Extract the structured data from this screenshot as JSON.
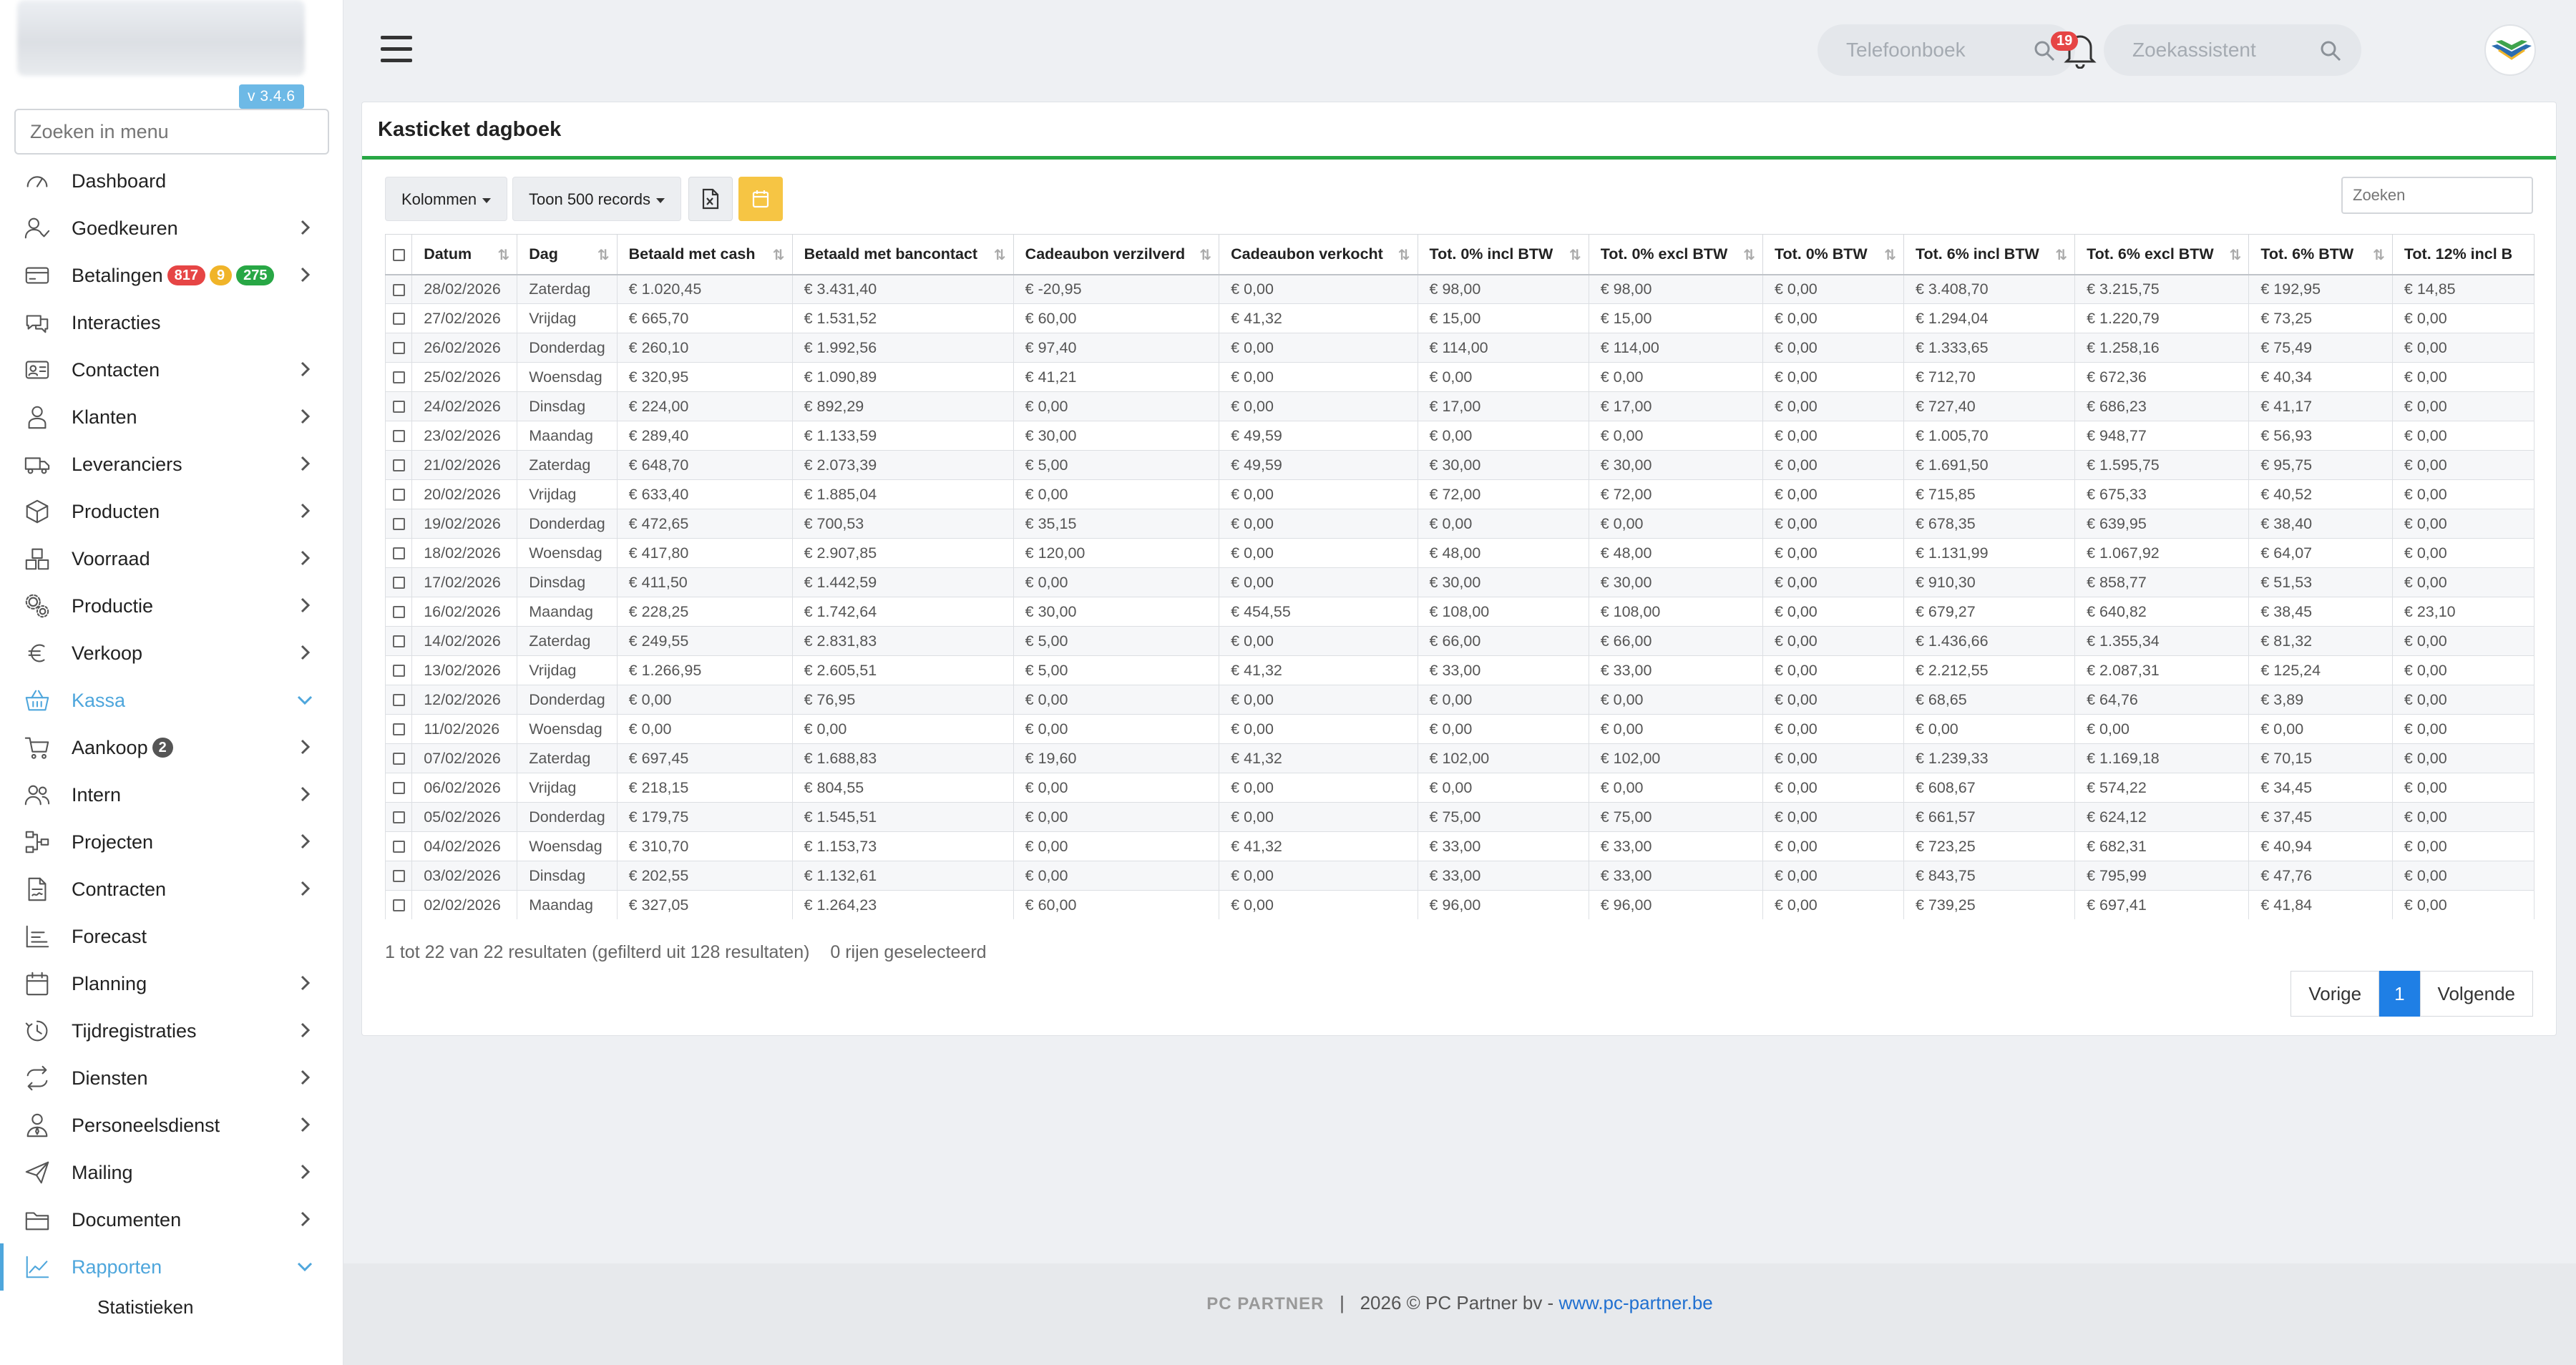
{
  "sidebar": {
    "version": "v 3.4.6",
    "search_placeholder": "Zoeken in menu",
    "items": [
      {
        "label": "Dashboard",
        "icon": "speedometer-icon",
        "chevron": false
      },
      {
        "label": "Goedkeuren",
        "icon": "user-check-icon",
        "chevron": true
      },
      {
        "label": "Betalingen",
        "icon": "credit-card-icon",
        "chevron": true,
        "badges": [
          "817",
          "9",
          "275"
        ]
      },
      {
        "label": "Interacties",
        "icon": "chat-icon",
        "chevron": false
      },
      {
        "label": "Contacten",
        "icon": "contact-card-icon",
        "chevron": true
      },
      {
        "label": "Klanten",
        "icon": "user-icon",
        "chevron": true
      },
      {
        "label": "Leveranciers",
        "icon": "truck-icon",
        "chevron": true
      },
      {
        "label": "Producten",
        "icon": "box-icon",
        "chevron": true
      },
      {
        "label": "Voorraad",
        "icon": "boxes-icon",
        "chevron": true
      },
      {
        "label": "Productie",
        "icon": "gears-icon",
        "chevron": true
      },
      {
        "label": "Verkoop",
        "icon": "euro-icon",
        "chevron": true
      },
      {
        "label": "Kassa",
        "icon": "basket-icon",
        "chevron": true,
        "active": true
      },
      {
        "label": "Aankoop",
        "icon": "cart-icon",
        "chevron": true,
        "badges": [
          "2"
        ]
      },
      {
        "label": "Intern",
        "icon": "users-icon",
        "chevron": true
      },
      {
        "label": "Projecten",
        "icon": "project-icon",
        "chevron": true
      },
      {
        "label": "Contracten",
        "icon": "contract-icon",
        "chevron": true
      },
      {
        "label": "Forecast",
        "icon": "bar-chart-icon",
        "chevron": false
      },
      {
        "label": "Planning",
        "icon": "calendar-icon",
        "chevron": true
      },
      {
        "label": "Tijdregistraties",
        "icon": "clock-icon",
        "chevron": true
      },
      {
        "label": "Diensten",
        "icon": "repeat-icon",
        "chevron": true
      },
      {
        "label": "Personeelsdienst",
        "icon": "person-tie-icon",
        "chevron": true
      },
      {
        "label": "Mailing",
        "icon": "send-icon",
        "chevron": true
      },
      {
        "label": "Documenten",
        "icon": "folder-icon",
        "chevron": true
      },
      {
        "label": "Rapporten",
        "icon": "line-chart-icon",
        "chevron": true,
        "active": true
      }
    ],
    "sub_items": [
      "Statistieken"
    ]
  },
  "header": {
    "phonebook_placeholder": "Telefoonboek",
    "assistant_placeholder": "Zoekassistent",
    "notification_count": "19"
  },
  "card": {
    "title": "Kasticket dagboek",
    "columns_button": "Kolommen",
    "records_button": "Toon 500 records",
    "table_search_placeholder": "Zoeken",
    "colors": {
      "accent": "#28a745",
      "calendar_button": "#f6c544",
      "primary": "#1f7fe5"
    }
  },
  "table": {
    "headers": [
      "Datum",
      "Dag",
      "Betaald met cash",
      "Betaald met bancontact",
      "Cadeaubon verzilverd",
      "Cadeaubon verkocht",
      "Tot. 0% incl BTW",
      "Tot. 0% excl BTW",
      "Tot. 0% BTW",
      "Tot. 6% incl BTW",
      "Tot. 6% excl BTW",
      "Tot. 6% BTW",
      "Tot. 12% incl B"
    ],
    "rows": [
      [
        "28/02/2026",
        "Zaterdag",
        "€ 1.020,45",
        "€ 3.431,40",
        "€ -20,95",
        "€ 0,00",
        "€ 98,00",
        "€ 98,00",
        "€ 0,00",
        "€ 3.408,70",
        "€ 3.215,75",
        "€ 192,95",
        "€ 14,85"
      ],
      [
        "27/02/2026",
        "Vrijdag",
        "€ 665,70",
        "€ 1.531,52",
        "€ 60,00",
        "€ 41,32",
        "€ 15,00",
        "€ 15,00",
        "€ 0,00",
        "€ 1.294,04",
        "€ 1.220,79",
        "€ 73,25",
        "€ 0,00"
      ],
      [
        "26/02/2026",
        "Donderdag",
        "€ 260,10",
        "€ 1.992,56",
        "€ 97,40",
        "€ 0,00",
        "€ 114,00",
        "€ 114,00",
        "€ 0,00",
        "€ 1.333,65",
        "€ 1.258,16",
        "€ 75,49",
        "€ 0,00"
      ],
      [
        "25/02/2026",
        "Woensdag",
        "€ 320,95",
        "€ 1.090,89",
        "€ 41,21",
        "€ 0,00",
        "€ 0,00",
        "€ 0,00",
        "€ 0,00",
        "€ 712,70",
        "€ 672,36",
        "€ 40,34",
        "€ 0,00"
      ],
      [
        "24/02/2026",
        "Dinsdag",
        "€ 224,00",
        "€ 892,29",
        "€ 0,00",
        "€ 0,00",
        "€ 17,00",
        "€ 17,00",
        "€ 0,00",
        "€ 727,40",
        "€ 686,23",
        "€ 41,17",
        "€ 0,00"
      ],
      [
        "23/02/2026",
        "Maandag",
        "€ 289,40",
        "€ 1.133,59",
        "€ 30,00",
        "€ 49,59",
        "€ 0,00",
        "€ 0,00",
        "€ 0,00",
        "€ 1.005,70",
        "€ 948,77",
        "€ 56,93",
        "€ 0,00"
      ],
      [
        "21/02/2026",
        "Zaterdag",
        "€ 648,70",
        "€ 2.073,39",
        "€ 5,00",
        "€ 49,59",
        "€ 30,00",
        "€ 30,00",
        "€ 0,00",
        "€ 1.691,50",
        "€ 1.595,75",
        "€ 95,75",
        "€ 0,00"
      ],
      [
        "20/02/2026",
        "Vrijdag",
        "€ 633,40",
        "€ 1.885,04",
        "€ 0,00",
        "€ 0,00",
        "€ 72,00",
        "€ 72,00",
        "€ 0,00",
        "€ 715,85",
        "€ 675,33",
        "€ 40,52",
        "€ 0,00"
      ],
      [
        "19/02/2026",
        "Donderdag",
        "€ 472,65",
        "€ 700,53",
        "€ 35,15",
        "€ 0,00",
        "€ 0,00",
        "€ 0,00",
        "€ 0,00",
        "€ 678,35",
        "€ 639,95",
        "€ 38,40",
        "€ 0,00"
      ],
      [
        "18/02/2026",
        "Woensdag",
        "€ 417,80",
        "€ 2.907,85",
        "€ 120,00",
        "€ 0,00",
        "€ 48,00",
        "€ 48,00",
        "€ 0,00",
        "€ 1.131,99",
        "€ 1.067,92",
        "€ 64,07",
        "€ 0,00"
      ],
      [
        "17/02/2026",
        "Dinsdag",
        "€ 411,50",
        "€ 1.442,59",
        "€ 0,00",
        "€ 0,00",
        "€ 30,00",
        "€ 30,00",
        "€ 0,00",
        "€ 910,30",
        "€ 858,77",
        "€ 51,53",
        "€ 0,00"
      ],
      [
        "16/02/2026",
        "Maandag",
        "€ 228,25",
        "€ 1.742,64",
        "€ 30,00",
        "€ 454,55",
        "€ 108,00",
        "€ 108,00",
        "€ 0,00",
        "€ 679,27",
        "€ 640,82",
        "€ 38,45",
        "€ 23,10"
      ],
      [
        "14/02/2026",
        "Zaterdag",
        "€ 249,55",
        "€ 2.831,83",
        "€ 5,00",
        "€ 0,00",
        "€ 66,00",
        "€ 66,00",
        "€ 0,00",
        "€ 1.436,66",
        "€ 1.355,34",
        "€ 81,32",
        "€ 0,00"
      ],
      [
        "13/02/2026",
        "Vrijdag",
        "€ 1.266,95",
        "€ 2.605,51",
        "€ 5,00",
        "€ 41,32",
        "€ 33,00",
        "€ 33,00",
        "€ 0,00",
        "€ 2.212,55",
        "€ 2.087,31",
        "€ 125,24",
        "€ 0,00"
      ],
      [
        "12/02/2026",
        "Donderdag",
        "€ 0,00",
        "€ 76,95",
        "€ 0,00",
        "€ 0,00",
        "€ 0,00",
        "€ 0,00",
        "€ 0,00",
        "€ 68,65",
        "€ 64,76",
        "€ 3,89",
        "€ 0,00"
      ],
      [
        "11/02/2026",
        "Woensdag",
        "€ 0,00",
        "€ 0,00",
        "€ 0,00",
        "€ 0,00",
        "€ 0,00",
        "€ 0,00",
        "€ 0,00",
        "€ 0,00",
        "€ 0,00",
        "€ 0,00",
        "€ 0,00"
      ],
      [
        "07/02/2026",
        "Zaterdag",
        "€ 697,45",
        "€ 1.688,83",
        "€ 19,60",
        "€ 41,32",
        "€ 102,00",
        "€ 102,00",
        "€ 0,00",
        "€ 1.239,33",
        "€ 1.169,18",
        "€ 70,15",
        "€ 0,00"
      ],
      [
        "06/02/2026",
        "Vrijdag",
        "€ 218,15",
        "€ 804,55",
        "€ 0,00",
        "€ 0,00",
        "€ 0,00",
        "€ 0,00",
        "€ 0,00",
        "€ 608,67",
        "€ 574,22",
        "€ 34,45",
        "€ 0,00"
      ],
      [
        "05/02/2026",
        "Donderdag",
        "€ 179,75",
        "€ 1.545,51",
        "€ 0,00",
        "€ 0,00",
        "€ 75,00",
        "€ 75,00",
        "€ 0,00",
        "€ 661,57",
        "€ 624,12",
        "€ 37,45",
        "€ 0,00"
      ],
      [
        "04/02/2026",
        "Woensdag",
        "€ 310,70",
        "€ 1.153,73",
        "€ 0,00",
        "€ 41,32",
        "€ 33,00",
        "€ 33,00",
        "€ 0,00",
        "€ 723,25",
        "€ 682,31",
        "€ 40,94",
        "€ 0,00"
      ],
      [
        "03/02/2026",
        "Dinsdag",
        "€ 202,55",
        "€ 1.132,61",
        "€ 0,00",
        "€ 0,00",
        "€ 33,00",
        "€ 33,00",
        "€ 0,00",
        "€ 843,75",
        "€ 795,99",
        "€ 47,76",
        "€ 0,00"
      ],
      [
        "02/02/2026",
        "Maandag",
        "€ 327,05",
        "€ 1.264,23",
        "€ 60,00",
        "€ 0,00",
        "€ 96,00",
        "€ 96,00",
        "€ 0,00",
        "€ 739,25",
        "€ 697,41",
        "€ 41,84",
        "€ 0,00"
      ]
    ]
  },
  "summary": {
    "results_text": "1 tot 22 van 22 resultaten (gefilterd uit 128 resultaten)",
    "selected_text": "0 rijen geselecteerd"
  },
  "pagination": {
    "prev": "Vorige",
    "current": "1",
    "next": "Volgende"
  },
  "footer": {
    "brand": "PC PARTNER",
    "text": "2026 © PC Partner bv - ",
    "link": "www.pc-partner.be"
  }
}
